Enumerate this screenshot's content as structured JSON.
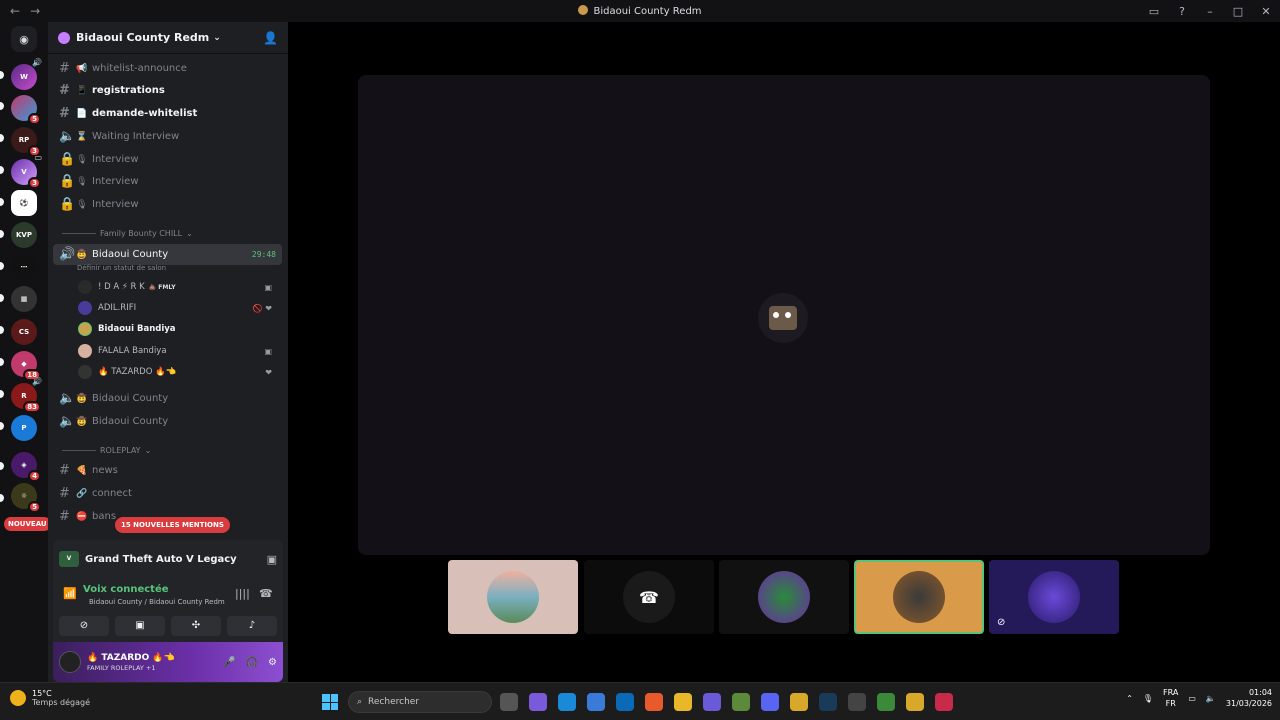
{
  "window": {
    "title": "Bidaoui County Redm"
  },
  "rail": {
    "nouveau_label": "NOUVEAU",
    "badges": [
      "5",
      "3",
      "3",
      "18",
      "83",
      "4",
      "5"
    ]
  },
  "server": {
    "name": "Bidaoui County Redm"
  },
  "channels": [
    {
      "name": "whitelist-announce",
      "type": "text",
      "emoji": "📢"
    },
    {
      "name": "registrations",
      "type": "text",
      "emoji": "📱",
      "unread": true
    },
    {
      "name": "demande-whitelist",
      "type": "text",
      "emoji": "📄",
      "unread": true
    },
    {
      "name": "Waiting Interview",
      "type": "voice",
      "emoji": "⌛"
    },
    {
      "name": "Interview",
      "type": "locked",
      "emoji": "🎙"
    },
    {
      "name": "Interview",
      "type": "locked",
      "emoji": "🎙"
    },
    {
      "name": "Interview",
      "type": "locked",
      "emoji": "🎙"
    }
  ],
  "categories": {
    "family": "Family Bounty CHILL",
    "roleplay": "ROLEPLAY"
  },
  "active_voice": {
    "name": "Bidaoui County",
    "timer": "29:48",
    "status": "Définir un statut de salon"
  },
  "members": [
    {
      "name": "! D A ⚡ R K",
      "tag": "💩 FMLY"
    },
    {
      "name": "ADIL.RIFI"
    },
    {
      "name": "Bidaoui Bandiya"
    },
    {
      "name": "FALALA Bandiya"
    },
    {
      "name": "🔥 TAZARDO 🔥👈"
    }
  ],
  "voice_channels_2": [
    {
      "name": "Bidaoui County"
    },
    {
      "name": "Bidaoui County"
    }
  ],
  "roleplay_channels": [
    {
      "name": "news",
      "emoji": "🍕"
    },
    {
      "name": "connect",
      "emoji": "🔗"
    },
    {
      "name": "bans",
      "emoji": "⛔"
    }
  ],
  "mentions_badge": "15 NOUVELLES MENTIONS",
  "activity": {
    "game": "Grand Theft Auto V Legacy"
  },
  "voice_panel": {
    "status": "Voix connectée",
    "location": "Bidaoui County / Bidaoui County Redm"
  },
  "user": {
    "name": "🔥 TAZARDO 🔥👈",
    "status": "FAMILY ROLEPLAY +1"
  },
  "taskbar": {
    "temp": "15°C",
    "weather": "Temps dégagé",
    "search_placeholder": "Rechercher",
    "lang1": "FRA",
    "lang2": "FR",
    "time": "01:04",
    "date": "31/03/2026"
  },
  "colors": {
    "accent_green": "#57c47a",
    "mention_red": "#d83c3e",
    "sidebar": "#1e1f22"
  }
}
